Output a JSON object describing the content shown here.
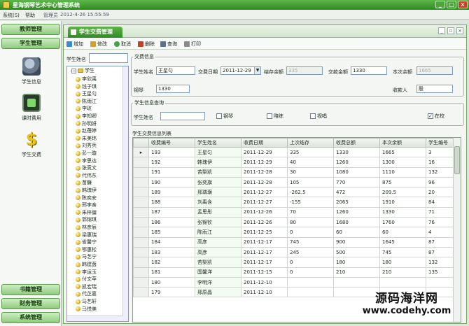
{
  "window": {
    "title": "星海钢琴艺术中心管理系统",
    "controls": [
      "_",
      "□",
      "×"
    ]
  },
  "menubar": {
    "system": "系统(S)",
    "help": "帮助",
    "user": "管理员",
    "datetime": "2012-4-26 15:55:59"
  },
  "sidebar": {
    "teacher_mgmt": "教师管理",
    "student_mgmt": "学生管理",
    "items": [
      {
        "label": "学生信息",
        "icon": "students-icon"
      },
      {
        "label": "课时费用",
        "icon": "lesson-fee-icon"
      },
      {
        "label": "学生交费",
        "icon": "dollar-icon"
      }
    ],
    "book_mgmt": "书籍管理",
    "finance_mgmt": "财务管理",
    "system_mgmt": "系统管理"
  },
  "tab": {
    "label": "学生交费管理"
  },
  "toolbar": {
    "add": "增加",
    "edit": "修改",
    "cancel": "取消",
    "delete": "删除",
    "query": "查询",
    "print": "打印"
  },
  "tree": {
    "search_label": "学生姓名",
    "root": "学生",
    "nodes": [
      "李欣禹",
      "钱子琪",
      "王星匀",
      "陈雨江",
      "李玫",
      "李知卿",
      "孙明妍",
      "赵蓓婷",
      "朱美玮",
      "刘秀兵",
      "彭一璇",
      "李思达",
      "张竞文",
      "代伟东",
      "苗鐮",
      "韩瑰伊",
      "陈奕安",
      "邢李亲",
      "朱梓僵",
      "郭锦琪",
      "林彦辰",
      "梁惠瑞",
      "雀馨宁",
      "鄂惠松",
      "马艺宁",
      "韩建茵",
      "李运玉",
      "付文苹",
      "凯宏瑞",
      "代芷嘉",
      "马艺轩",
      "马悦美"
    ]
  },
  "fee_info": {
    "legend": "交费信息",
    "student_name_label": "学生姓名",
    "student_name_value": "王星匀",
    "date_label": "交费日期",
    "date_value": "2011-12-29",
    "prev_balance_label": "结存余额",
    "prev_balance_value": "335",
    "pay_amount_label": "交款金额",
    "pay_amount_value": "1330",
    "current_balance_label": "本次余额",
    "current_balance_value": "1665",
    "piano_label": "钢琴",
    "piano_value": "1330",
    "payee_label": "收款人",
    "payee_value": "殷"
  },
  "student_query": {
    "legend": "学生信息查询",
    "name_label": "学生姓名",
    "name_value": "",
    "options": [
      {
        "label": "钢琴",
        "checked": false
      },
      {
        "label": "陪练",
        "checked": false
      },
      {
        "label": "视唱",
        "checked": false
      }
    ],
    "in_school_label": "在校",
    "in_school_checked": true
  },
  "fee_list": {
    "legend": "学生交费信息列表",
    "columns": [
      "收费编号",
      "学生姓名",
      "收费日期",
      "上次结存",
      "收费总额",
      "本次余额",
      "学生编号"
    ],
    "rows": [
      [
        "193",
        "王星匀",
        "2011-12-29",
        "335",
        "1330",
        "1665",
        "3"
      ],
      [
        "192",
        "韩瑰伊",
        "2011-12-29",
        "40",
        "1260",
        "1300",
        "16"
      ],
      [
        "191",
        "苦梨凯",
        "2011-12-28",
        "30",
        "1080",
        "1110",
        "132"
      ],
      [
        "190",
        "张奕旗",
        "2011-12-28",
        "105",
        "770",
        "875",
        "96"
      ],
      [
        "189",
        "邢璘璜",
        "2011-12-27",
        "-262.5",
        "472",
        "209.5",
        "20"
      ],
      [
        "188",
        "刘禹含",
        "2011-12-27",
        "-155",
        "2065",
        "1910",
        "84"
      ],
      [
        "187",
        "孟思彤",
        "2011-12-26",
        "70",
        "1260",
        "1330",
        "71"
      ],
      [
        "186",
        "张锦钦",
        "2011-12-26",
        "80",
        "1680",
        "1760",
        "76"
      ],
      [
        "185",
        "陈雨江",
        "2011-12-25",
        "0",
        "60",
        "60",
        "4"
      ],
      [
        "184",
        "高彦",
        "2011-12-17",
        "745",
        "900",
        "1645",
        "87"
      ],
      [
        "183",
        "高彦",
        "2011-12-17",
        "245",
        "500",
        "745",
        "87"
      ],
      [
        "182",
        "苦梨凯",
        "2011-12-17",
        "0",
        "180",
        "180",
        "132"
      ],
      [
        "181",
        "国馨洋",
        "2011-12-15",
        "0",
        "210",
        "210",
        "135"
      ],
      [
        "180",
        "李明洋",
        "2011-12-10",
        "",
        "",
        "",
        ""
      ],
      [
        "179",
        "邢原晶",
        "2011-12-10",
        "",
        "",
        "",
        ""
      ]
    ]
  },
  "watermark": {
    "line1": "源码海洋网",
    "line2": "www.codehy.com"
  }
}
